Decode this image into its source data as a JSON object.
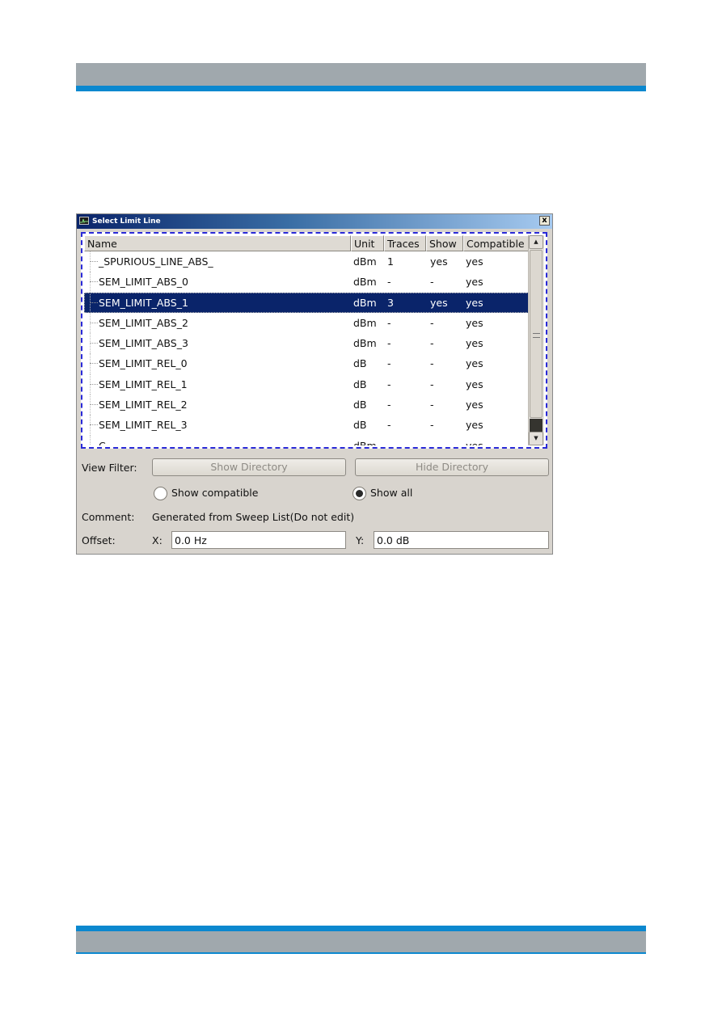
{
  "page": {
    "accent_blue": "#0b88cf",
    "band_gray": "#a0a8ad"
  },
  "dialog": {
    "title": "Select Limit Line",
    "close_label": "x",
    "columns": [
      "Name",
      "Unit",
      "Traces",
      "Show",
      "Compatible"
    ],
    "rows": [
      {
        "name": "_SPURIOUS_LINE_ABS_",
        "unit": "dBm",
        "traces": "1",
        "show": "yes",
        "compatible": "yes",
        "selected": false
      },
      {
        "name": "SEM_LIMIT_ABS_0",
        "unit": "dBm",
        "traces": "-",
        "show": "-",
        "compatible": "yes",
        "selected": false
      },
      {
        "name": "SEM_LIMIT_ABS_1",
        "unit": "dBm",
        "traces": "3",
        "show": "yes",
        "compatible": "yes",
        "selected": true
      },
      {
        "name": "SEM_LIMIT_ABS_2",
        "unit": "dBm",
        "traces": "-",
        "show": "-",
        "compatible": "yes",
        "selected": false
      },
      {
        "name": "SEM_LIMIT_ABS_3",
        "unit": "dBm",
        "traces": "-",
        "show": "-",
        "compatible": "yes",
        "selected": false
      },
      {
        "name": "SEM_LIMIT_REL_0",
        "unit": "dB",
        "traces": "-",
        "show": "-",
        "compatible": "yes",
        "selected": false
      },
      {
        "name": "SEM_LIMIT_REL_1",
        "unit": "dB",
        "traces": "-",
        "show": "-",
        "compatible": "yes",
        "selected": false
      },
      {
        "name": "SEM_LIMIT_REL_2",
        "unit": "dB",
        "traces": "-",
        "show": "-",
        "compatible": "yes",
        "selected": false
      },
      {
        "name": "SEM_LIMIT_REL_3",
        "unit": "dB",
        "traces": "-",
        "show": "-",
        "compatible": "yes",
        "selected": false
      },
      {
        "name": "C",
        "unit": "dBm",
        "traces": "-",
        "show": "-",
        "compatible": "yes",
        "selected": false
      }
    ],
    "view_filter": {
      "label": "View Filter:",
      "show_directory": "Show Directory",
      "hide_directory": "Hide Directory"
    },
    "radios": {
      "show_compatible": {
        "label": "Show compatible",
        "checked": false
      },
      "show_all": {
        "label": "Show all",
        "checked": true
      }
    },
    "comment": {
      "label": "Comment:",
      "value": "Generated from Sweep List(Do not edit)"
    },
    "offset": {
      "label": "Offset:",
      "x_label": "X:",
      "x_value": "0.0 Hz",
      "y_label": "Y:",
      "y_value": "0.0 dB"
    }
  }
}
